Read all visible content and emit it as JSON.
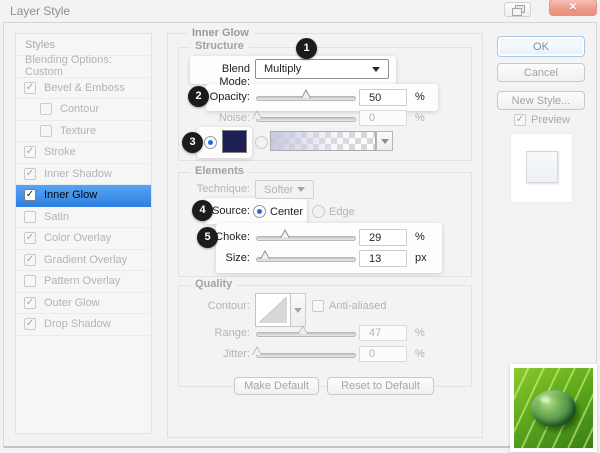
{
  "window": {
    "title": "Layer Style"
  },
  "icons": {
    "check": "✓",
    "close": "✕"
  },
  "sidebar": {
    "header": "Styles",
    "blending_options": "Blending Options: Custom",
    "items": [
      {
        "label": "Bevel & Emboss",
        "checked": true,
        "indent": false,
        "selected": false
      },
      {
        "label": "Contour",
        "checked": false,
        "indent": true,
        "selected": false
      },
      {
        "label": "Texture",
        "checked": false,
        "indent": true,
        "selected": false
      },
      {
        "label": "Stroke",
        "checked": true,
        "indent": false,
        "selected": false
      },
      {
        "label": "Inner Shadow",
        "checked": true,
        "indent": false,
        "selected": false
      },
      {
        "label": "Inner Glow",
        "checked": true,
        "indent": false,
        "selected": true
      },
      {
        "label": "Satin",
        "checked": false,
        "indent": false,
        "selected": false
      },
      {
        "label": "Color Overlay",
        "checked": true,
        "indent": false,
        "selected": false
      },
      {
        "label": "Gradient Overlay",
        "checked": true,
        "indent": false,
        "selected": false
      },
      {
        "label": "Pattern Overlay",
        "checked": false,
        "indent": false,
        "selected": false
      },
      {
        "label": "Outer Glow",
        "checked": true,
        "indent": false,
        "selected": false
      },
      {
        "label": "Drop Shadow",
        "checked": true,
        "indent": false,
        "selected": false
      }
    ]
  },
  "main": {
    "panel_title": "Inner Glow",
    "structure": {
      "legend": "Structure",
      "blend_mode_label": "Blend Mode:",
      "blend_mode_value": "Multiply",
      "opacity_label": "Opacity:",
      "opacity_value": "50",
      "opacity_unit": "%",
      "noise_label": "Noise:",
      "noise_value": "0",
      "noise_unit": "%"
    },
    "elements": {
      "legend": "Elements",
      "technique_label": "Technique:",
      "technique_value": "Softer",
      "source_label": "Source:",
      "source_center_label": "Center",
      "source_edge_label": "Edge",
      "choke_label": "Choke:",
      "choke_value": "29",
      "choke_unit": "%",
      "size_label": "Size:",
      "size_value": "13",
      "size_unit": "px"
    },
    "quality": {
      "legend": "Quality",
      "contour_label": "Contour:",
      "antialiased_label": "Anti-aliased",
      "range_label": "Range:",
      "range_value": "47",
      "range_unit": "%",
      "jitter_label": "Jitter:",
      "jitter_value": "0",
      "jitter_unit": "%"
    },
    "footer": {
      "make_default": "Make Default",
      "reset_to_default": "Reset to Default"
    }
  },
  "actions": {
    "ok": "OK",
    "cancel": "Cancel",
    "new_style": "New Style...",
    "preview_label": "Preview"
  },
  "annotations": {
    "n1": "1",
    "n2": "2",
    "n3": "3",
    "n4": "4",
    "n5": "5"
  },
  "colors": {
    "selection_blue": "#3b8de8",
    "glow_color_swatch": "#1d1f55",
    "close_button_red": "#ec9383",
    "leaf_green": "#58a31a",
    "badge_black": "#1b1b1d"
  },
  "sliders": {
    "opacity": 50,
    "noise": 0,
    "choke": 29,
    "size": 8,
    "range": 47,
    "jitter": 0
  }
}
